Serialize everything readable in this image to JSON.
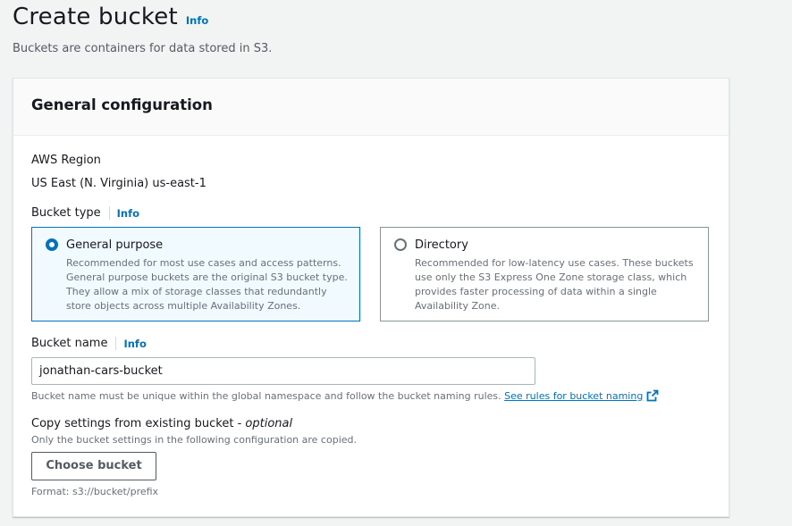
{
  "page": {
    "title": "Create bucket",
    "title_info": "Info",
    "subtitle": "Buckets are containers for data stored in S3."
  },
  "general_config": {
    "title": "General configuration",
    "region_label": "AWS Region",
    "region_value": "US East (N. Virginia) us-east-1",
    "bucket_type": {
      "label": "Bucket type",
      "info": "Info",
      "options": [
        {
          "title": "General purpose",
          "description": "Recommended for most use cases and access patterns. General purpose buckets are the original S3 bucket type. They allow a mix of storage classes that redundantly store objects across multiple Availability Zones.",
          "selected": true
        },
        {
          "title": "Directory",
          "description": "Recommended for low-latency use cases. These buckets use only the S3 Express One Zone storage class, which provides faster processing of data within a single Availability Zone.",
          "selected": false
        }
      ]
    },
    "bucket_name": {
      "label": "Bucket name",
      "info": "Info",
      "value": "jonathan-cars-bucket",
      "hint": "Bucket name must be unique within the global namespace and follow the bucket naming rules.",
      "hint_link": "See rules for bucket naming"
    },
    "copy_settings": {
      "label": "Copy settings from existing bucket - ",
      "optional": "optional",
      "description": "Only the bucket settings in the following configuration are copied.",
      "button": "Choose bucket",
      "format_hint": "Format: s3://bucket/prefix"
    }
  },
  "colors": {
    "accent": "#0073bb",
    "text": "#16191f",
    "muted": "#687078",
    "selected_bg": "#f1faff",
    "page_bg": "#f2f3f3"
  }
}
